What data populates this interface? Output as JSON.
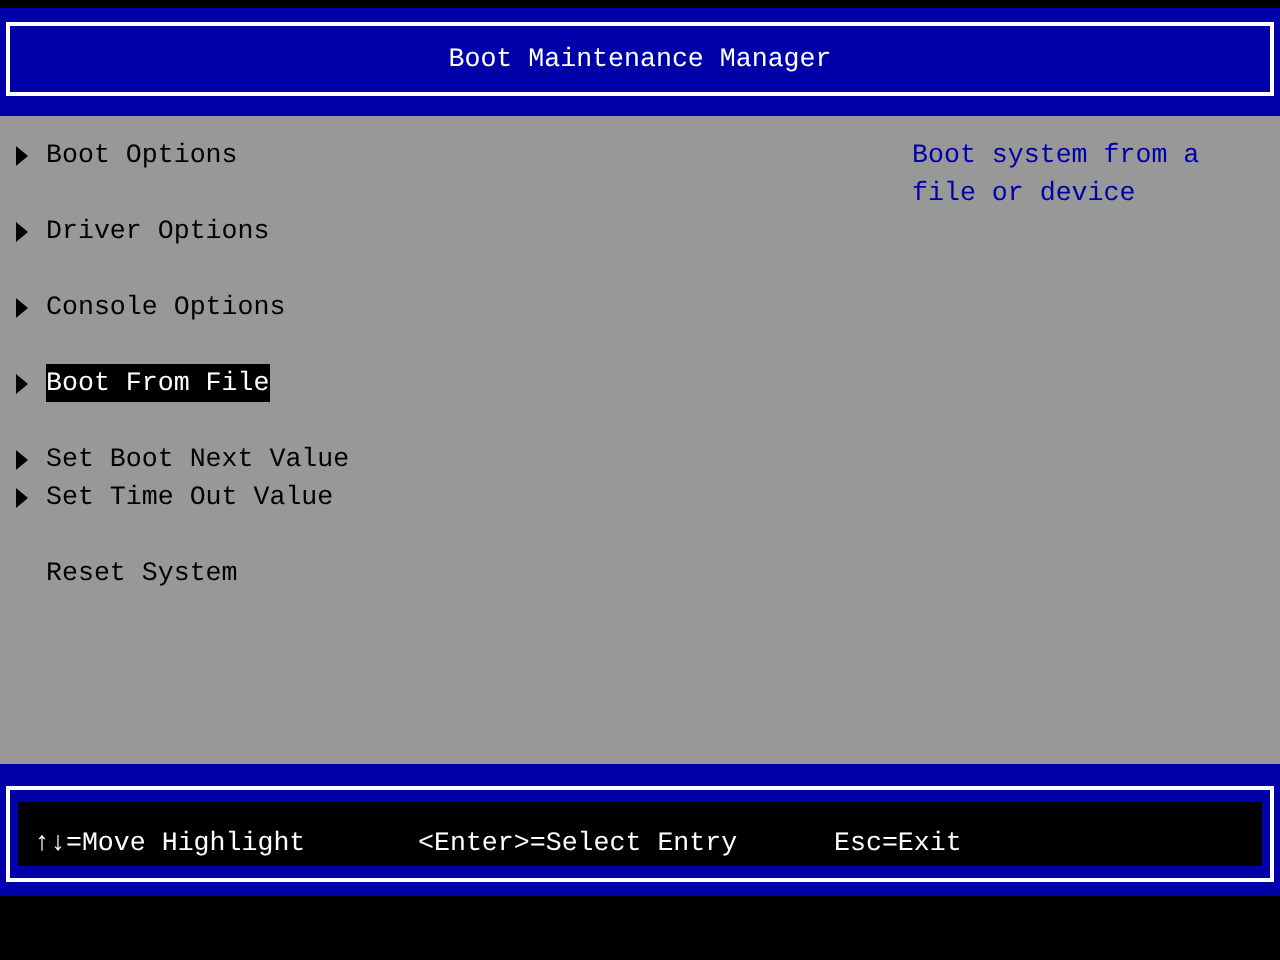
{
  "header": {
    "title": "Boot Maintenance Manager"
  },
  "menu_groups": [
    [
      {
        "label": "Boot Options",
        "submenu": true,
        "selected": false
      }
    ],
    [
      {
        "label": "Driver Options",
        "submenu": true,
        "selected": false
      }
    ],
    [
      {
        "label": "Console Options",
        "submenu": true,
        "selected": false
      }
    ],
    [
      {
        "label": "Boot From File",
        "submenu": true,
        "selected": true
      }
    ],
    [
      {
        "label": "Set Boot Next Value",
        "submenu": true,
        "selected": false
      },
      {
        "label": "Set Time Out Value",
        "submenu": true,
        "selected": false
      }
    ],
    [
      {
        "label": "Reset System",
        "submenu": false,
        "selected": false
      }
    ]
  ],
  "help_text": "Boot system from a file or device",
  "footer": {
    "hints": [
      "↑↓=Move Highlight",
      "<Enter>=Select Entry",
      "Esc=Exit"
    ]
  }
}
